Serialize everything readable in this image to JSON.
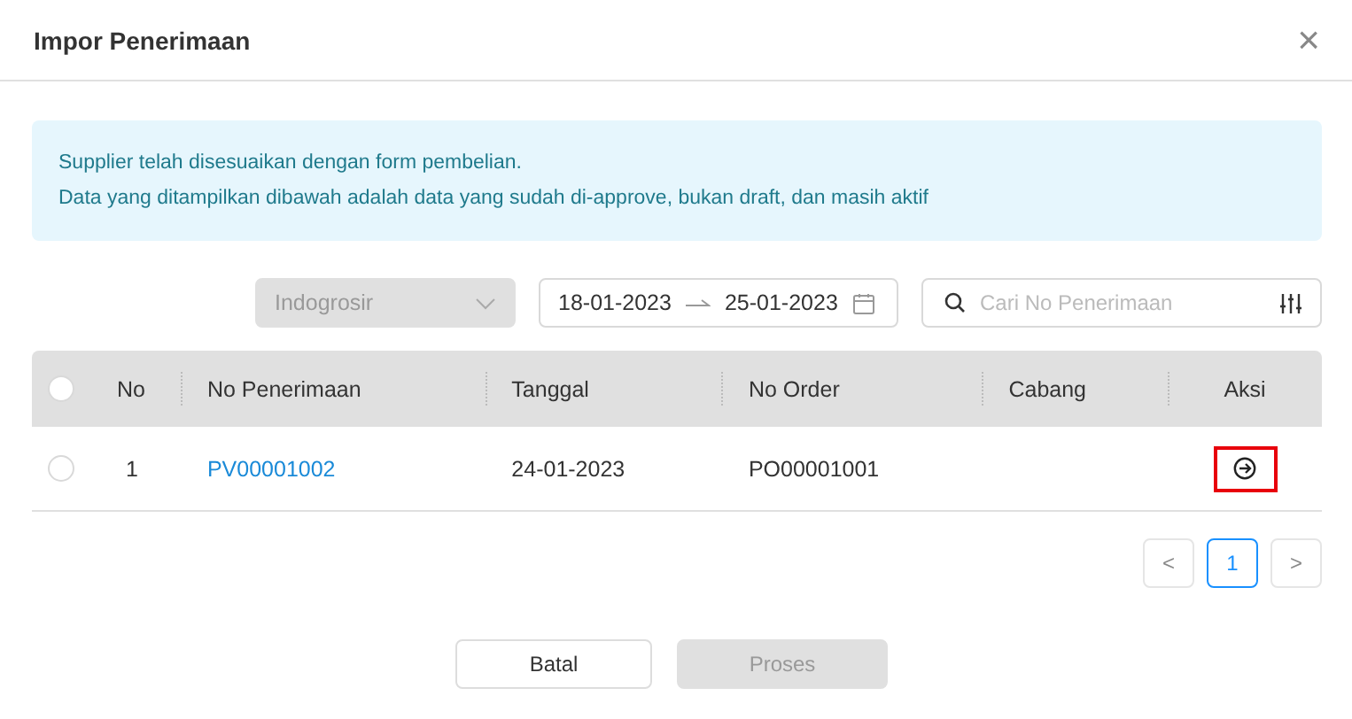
{
  "dialog": {
    "title": "Impor Penerimaan",
    "close": "×"
  },
  "alert": {
    "lines": [
      "Supplier telah disesuaikan dengan form pembelian.",
      "Data yang ditampilkan dibawah adalah data yang sudah di-approve, bukan draft, dan masih aktif"
    ]
  },
  "filters": {
    "supplier": {
      "value": "Indogrosir",
      "disabled": true
    },
    "date_range": {
      "start": "18-01-2023",
      "end": "25-01-2023"
    },
    "search": {
      "placeholder": "Cari No Penerimaan"
    }
  },
  "table": {
    "select_all_checked": false,
    "columns": [
      "No",
      "No Penerimaan",
      "Tanggal",
      "No Order",
      "Cabang",
      "Aksi"
    ],
    "rows": [
      {
        "checked": false,
        "no": "1",
        "no_penerimaan": "PV00001002",
        "tanggal": "24-01-2023",
        "no_order": "PO00001001",
        "cabang": "",
        "action_highlighted": true
      }
    ]
  },
  "pagination": {
    "prev": "<",
    "next": ">",
    "pages": [
      {
        "label": "1",
        "selected": true
      }
    ]
  },
  "buttons": [
    {
      "label": "Batal",
      "disabled": false
    },
    {
      "label": "Proses",
      "disabled": true
    }
  ]
}
